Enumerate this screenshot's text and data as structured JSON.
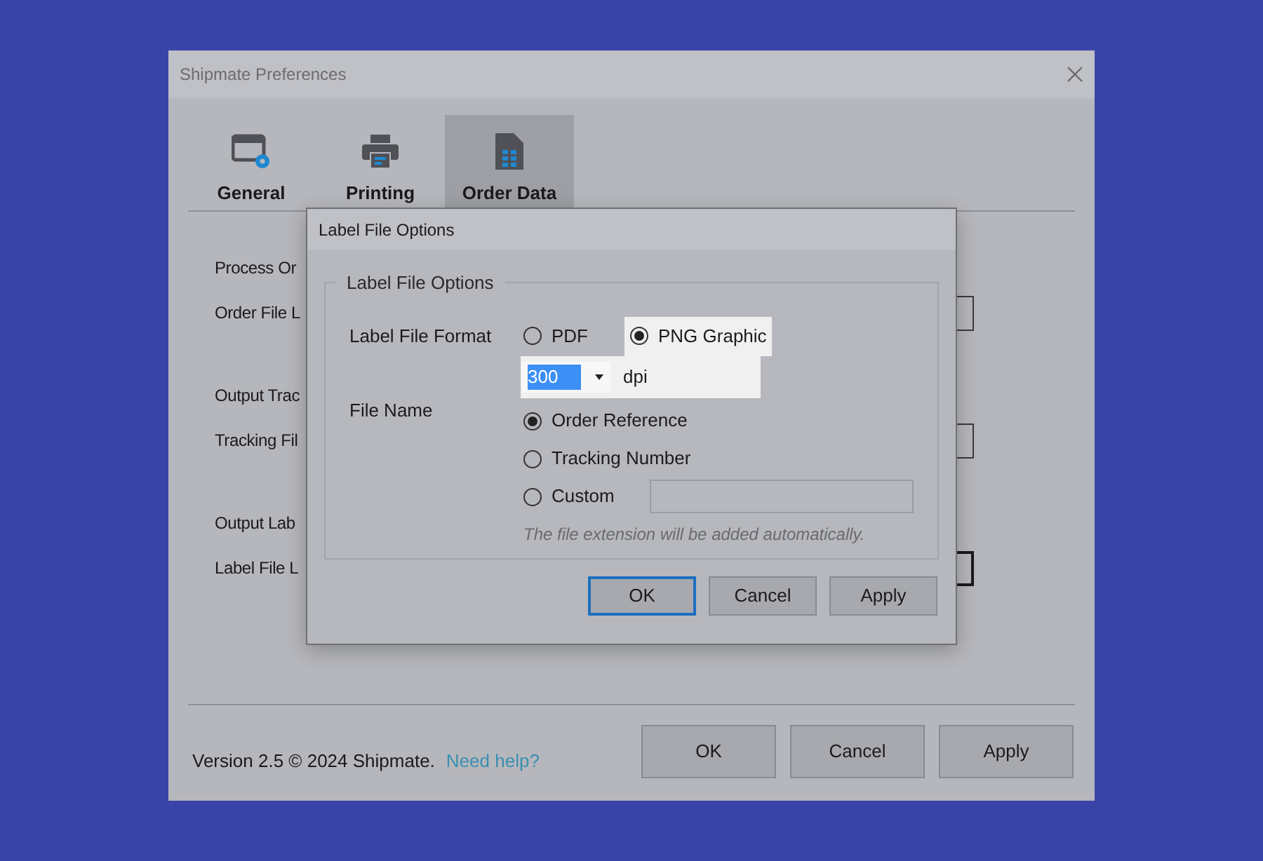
{
  "window": {
    "title": "Shipmate Preferences"
  },
  "tabs": [
    {
      "label": "General",
      "kind": "general",
      "selected": false
    },
    {
      "label": "Printing",
      "kind": "printing",
      "selected": false
    },
    {
      "label": "Order Data",
      "kind": "orderdata",
      "selected": true
    }
  ],
  "settings": [
    {
      "label": "Process Or",
      "kind": "text"
    },
    {
      "label": "Order File L",
      "kind": "path",
      "focused": false
    },
    {
      "label": "Output Trac",
      "kind": "text"
    },
    {
      "label": "Tracking Fil",
      "kind": "path",
      "focused": false
    },
    {
      "label": "Output Lab",
      "kind": "text"
    },
    {
      "label": "Label File L",
      "kind": "path",
      "focused": true
    }
  ],
  "footer": {
    "version": "Version 2.5 © 2024 Shipmate.",
    "help_link": "Need help?"
  },
  "buttons": [
    "OK",
    "Cancel",
    "Apply"
  ],
  "dialog": {
    "title": "Label File Options",
    "group_title": "Label File Options",
    "format_label": "Label File Format",
    "format_options": [
      {
        "label": "PDF",
        "selected": false,
        "highlighted": false
      },
      {
        "label": "PNG Graphic",
        "selected": true,
        "highlighted": true
      }
    ],
    "dpi": {
      "value": "300",
      "unit": "dpi"
    },
    "file_name_label": "File Name",
    "file_name_options": [
      {
        "label": "Order Reference",
        "selected": true
      },
      {
        "label": "Tracking Number",
        "selected": false
      },
      {
        "label": "Custom",
        "selected": false
      }
    ],
    "hint": "The file extension will be added automatically.",
    "buttons": [
      {
        "label": "OK",
        "default": true
      },
      {
        "label": "Cancel",
        "default": false
      },
      {
        "label": "Apply",
        "default": false
      }
    ]
  }
}
